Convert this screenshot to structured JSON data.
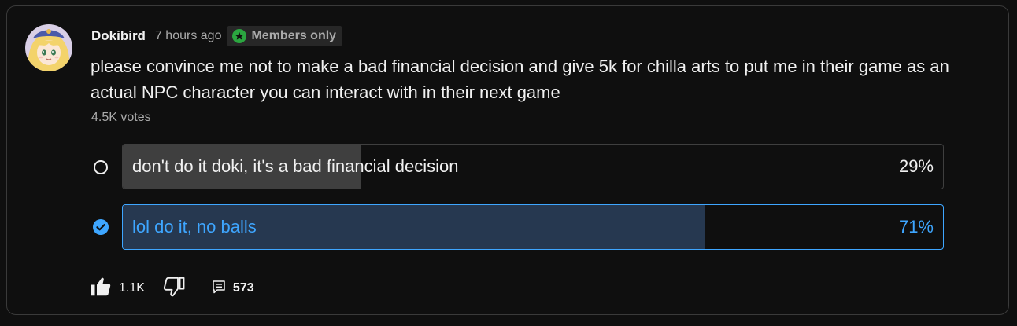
{
  "post": {
    "author": "Dokibird",
    "time": "7 hours ago",
    "members_badge": "Members only",
    "text": "please convince me not to make a bad financial decision and give 5k for chilla arts to put me in their game as an actual NPC character you can interact with in their next game",
    "votes": "4.5K votes"
  },
  "poll": {
    "options": [
      {
        "label": "don't do it doki, it's a bad financial decision",
        "percent": "29%",
        "fraction": 0.29,
        "selected": false
      },
      {
        "label": "lol do it, no balls",
        "percent": "71%",
        "fraction": 0.71,
        "selected": true
      }
    ]
  },
  "actions": {
    "like_icon": "thumbs-up-icon",
    "like_count": "1.1K",
    "dislike_icon": "thumbs-down-icon",
    "comments_icon": "comments-icon",
    "comment_count": "573"
  },
  "colors": {
    "accent": "#3ea6ff",
    "members_badge_star": "#2ba640",
    "background": "#0f0f0f"
  }
}
